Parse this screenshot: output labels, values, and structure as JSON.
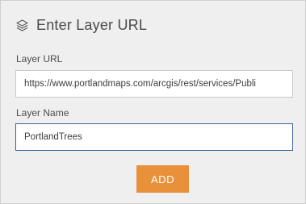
{
  "header": {
    "title": "Enter Layer URL",
    "icon": "layers-icon"
  },
  "form": {
    "url_label": "Layer URL",
    "url_value": "https://www.portlandmaps.com/arcgis/rest/services/Publi",
    "name_label": "Layer Name",
    "name_value": "PortlandTrees",
    "add_label": "ADD"
  },
  "colors": {
    "panel_bg": "#efefef",
    "accent": "#e9903a",
    "focus_border": "#3a5f99"
  }
}
